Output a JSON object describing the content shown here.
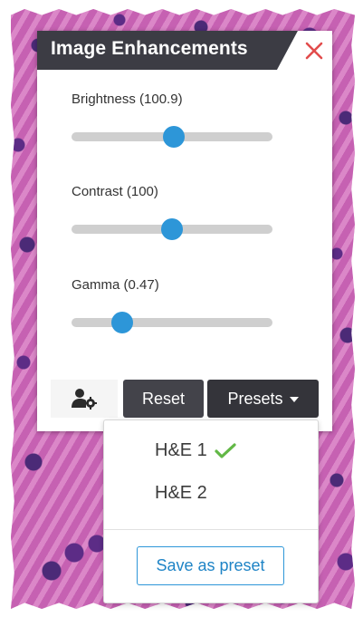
{
  "panel": {
    "title": "Image Enhancements"
  },
  "sliders": [
    {
      "name": "brightness",
      "label": "Brightness (100.9)",
      "value": 100.9,
      "level": 0.51
    },
    {
      "name": "contrast",
      "label": "Contrast (100)",
      "value": 100,
      "level": 0.5
    },
    {
      "name": "gamma",
      "label": "Gamma (0.47)",
      "value": 0.47,
      "level": 0.25
    }
  ],
  "buttons": {
    "reset": "Reset",
    "presets": "Presets"
  },
  "presets_menu": {
    "items": [
      {
        "label": "H&E 1",
        "selected": true
      },
      {
        "label": "H&E 2",
        "selected": false
      }
    ],
    "save_label": "Save as preset"
  },
  "colors": {
    "header": "#3c3c44",
    "close": "#e24c4c",
    "accent": "#2d96d8",
    "check": "#62b846",
    "button_dark": "#43434a",
    "track": "#cfcfcf"
  },
  "icons": {
    "close": "close-icon",
    "user_settings": "user-settings-icon",
    "check": "check-icon",
    "caret": "caret-down-icon"
  }
}
